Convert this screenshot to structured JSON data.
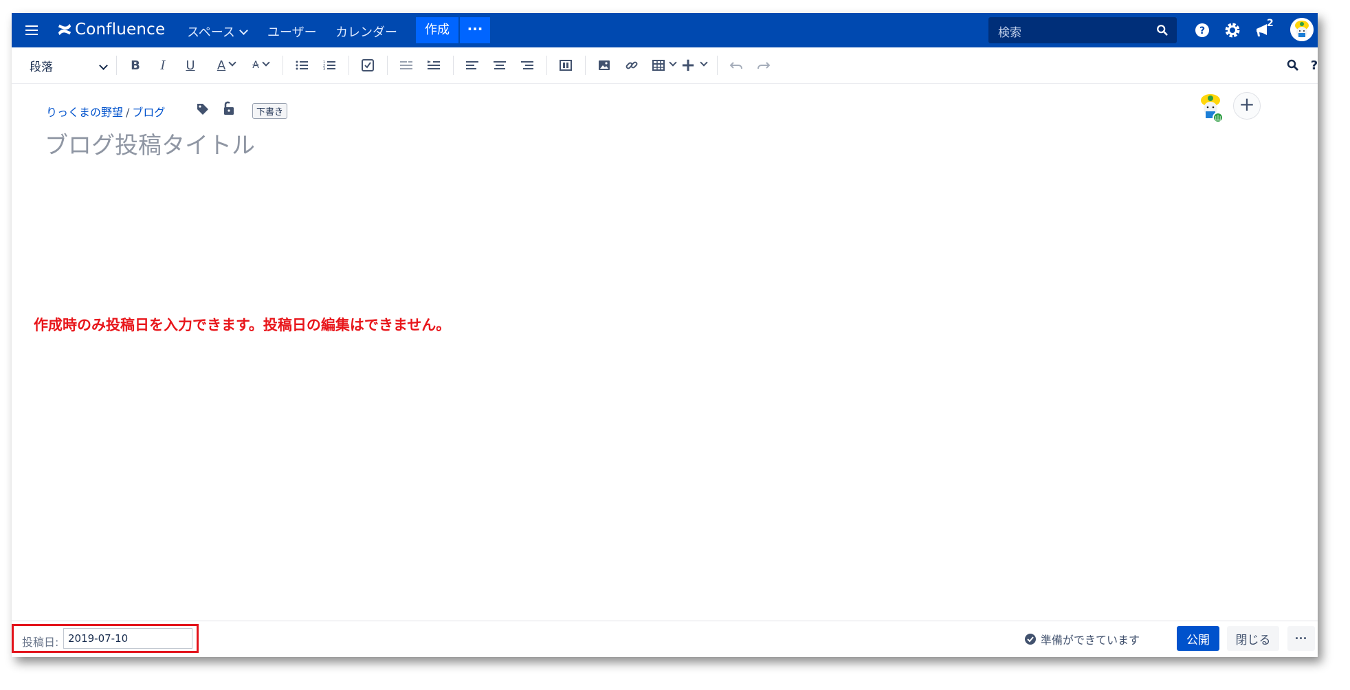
{
  "topnav": {
    "app_name": "Confluence",
    "nav_spaces": "スペース",
    "nav_users": "ユーザー",
    "nav_calendar": "カレンダー",
    "create_label": "作成",
    "more_label": "···",
    "search_placeholder": "検索",
    "notification_count": "2",
    "colors": {
      "bar": "#0049b0",
      "create": "#0065ff"
    }
  },
  "toolbar": {
    "paragraph_style": "段落",
    "icons": [
      "bold-icon",
      "italic-icon",
      "underline-icon",
      "text-color-icon",
      "clear-format-icon",
      "bullet-list-icon",
      "numbered-list-icon",
      "task-list-icon",
      "outdent-icon",
      "indent-icon",
      "align-left-icon",
      "align-center-icon",
      "align-right-icon",
      "layout-icon",
      "image-icon",
      "link-icon",
      "table-icon",
      "insert-icon",
      "undo-icon",
      "redo-icon",
      "find-icon",
      "help-icon"
    ]
  },
  "content": {
    "breadcrumb_space": "りっくまの野望",
    "breadcrumb_sep": "/",
    "breadcrumb_page": "ブログ",
    "draft_badge": "下書き",
    "title_placeholder": "ブログ投稿タイトル",
    "annotation": "作成時のみ投稿日を入力できます。投稿日の編集はできません。",
    "annotation_color": "#e8161b"
  },
  "footer": {
    "post_date_label": "投稿日:",
    "post_date_value": "2019-07-10",
    "status": "準備ができています",
    "publish_label": "公開",
    "close_label": "閉じる",
    "more_label": "···",
    "highlight_color": "#e3131b"
  }
}
